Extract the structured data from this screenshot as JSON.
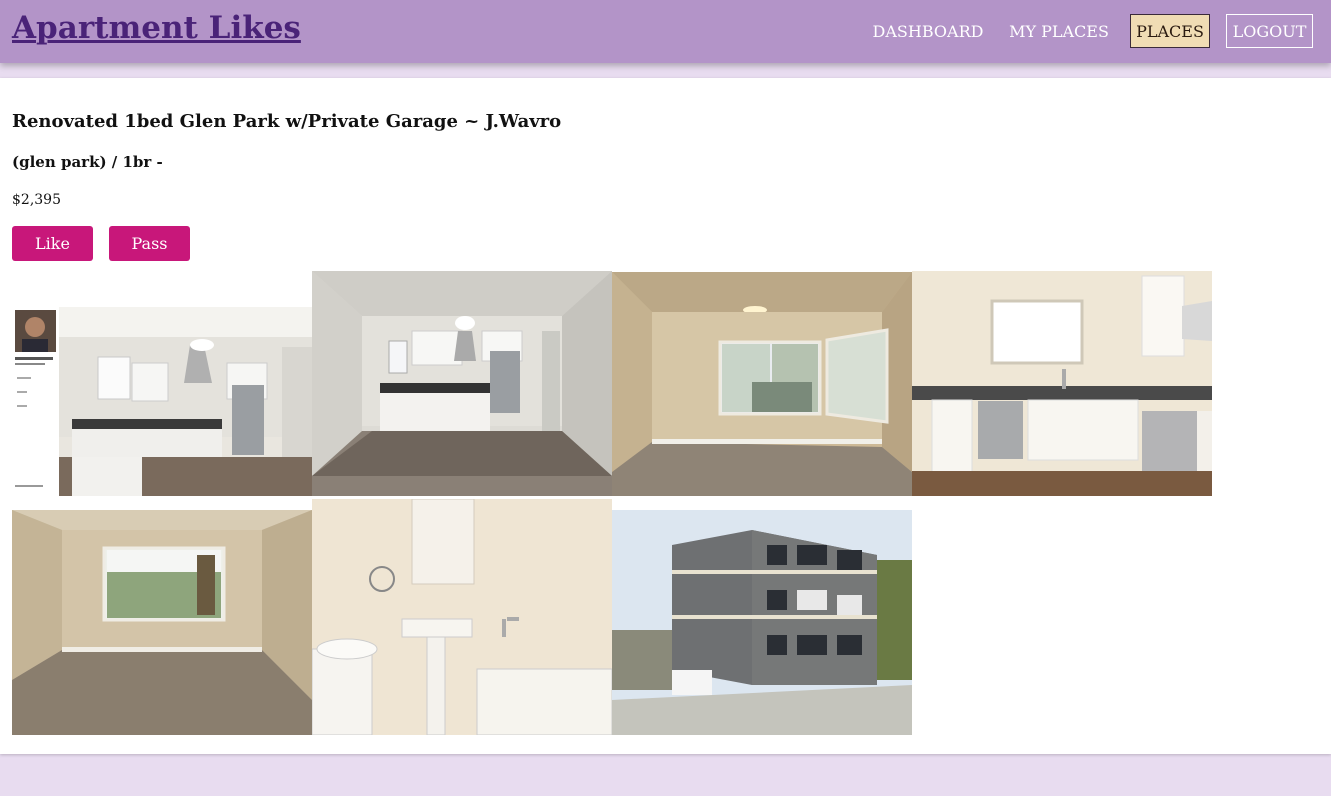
{
  "header": {
    "brand": "Apartment Likes",
    "nav": {
      "dashboard": "DASHBOARD",
      "my_places": "MY PLACES",
      "places": "PLACES",
      "logout": "LOGOUT"
    }
  },
  "listing": {
    "title": "Renovated 1bed Glen Park w/Private Garage ~ J.Wavro",
    "subtitle": "(glen park) / 1br -",
    "price": "$2,395",
    "like_label": "Like",
    "pass_label": "Pass",
    "photos": [
      {
        "name": "kitchen-with-agent-card"
      },
      {
        "name": "kitchen-wide"
      },
      {
        "name": "living-room-windows"
      },
      {
        "name": "kitchen-counter"
      },
      {
        "name": "bedroom-window"
      },
      {
        "name": "bathroom"
      },
      {
        "name": "building-exterior"
      }
    ]
  },
  "colors": {
    "header_bg": "#b394c8",
    "brand": "#4a2378",
    "active_nav_bg": "#f0dcb4",
    "button": "#c8177a",
    "page_bg": "#e8dcf0"
  }
}
